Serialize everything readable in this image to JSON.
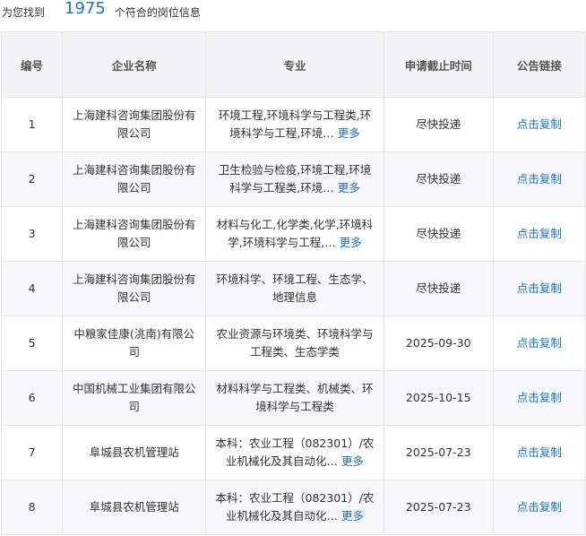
{
  "summary": {
    "prefix": "为您找到",
    "count": "1975",
    "suffix": "个符合的岗位信息"
  },
  "table": {
    "headers": [
      "编号",
      "企业名称",
      "专业",
      "申请截止时间",
      "公告链接"
    ],
    "more_label": "更多",
    "link_label": "点击复制",
    "rows": [
      {
        "no": "1",
        "company": "上海建科咨询集团股份有限公司",
        "major": "环境工程,环境科学与工程类,环境科学与工程,环境…",
        "has_more": true,
        "deadline": "尽快投递"
      },
      {
        "no": "2",
        "company": "上海建科咨询集团股份有限公司",
        "major": "卫生检验与检疫,环境工程,环境科学与工程类,环境…",
        "has_more": true,
        "deadline": "尽快投递"
      },
      {
        "no": "3",
        "company": "上海建科咨询集团股份有限公司",
        "major": "材料与化工,化学类,化学,环境科学,环境科学与工程,…",
        "has_more": true,
        "deadline": "尽快投递"
      },
      {
        "no": "4",
        "company": "上海建科咨询集团股份有限公司",
        "major": "环境科学、环境工程、生态学、地理信息",
        "has_more": false,
        "deadline": "尽快投递"
      },
      {
        "no": "5",
        "company": "中粮家佳康(洮南)有限公司",
        "major": "农业资源与环境类、环境科学与工程类、生态学类",
        "has_more": false,
        "deadline": "2025-09-30"
      },
      {
        "no": "6",
        "company": "中国机械工业集团有限公司",
        "major": "材料科学与工程类、机械类、环境科学与工程类",
        "has_more": false,
        "deadline": "2025-10-15"
      },
      {
        "no": "7",
        "company": "阜城县农机管理站",
        "major": "本科：农业工程（082301）/农业机械化及其自动化…",
        "has_more": true,
        "deadline": "2025-07-23"
      },
      {
        "no": "8",
        "company": "阜城县农机管理站",
        "major": "本科：农业工程（082301）/农业机械化及其自动化…",
        "has_more": true,
        "deadline": "2025-07-23"
      }
    ]
  },
  "colors": {
    "link": "#1a73c4",
    "header_bg": "#f3f4f6",
    "border": "#e6e6e6"
  }
}
